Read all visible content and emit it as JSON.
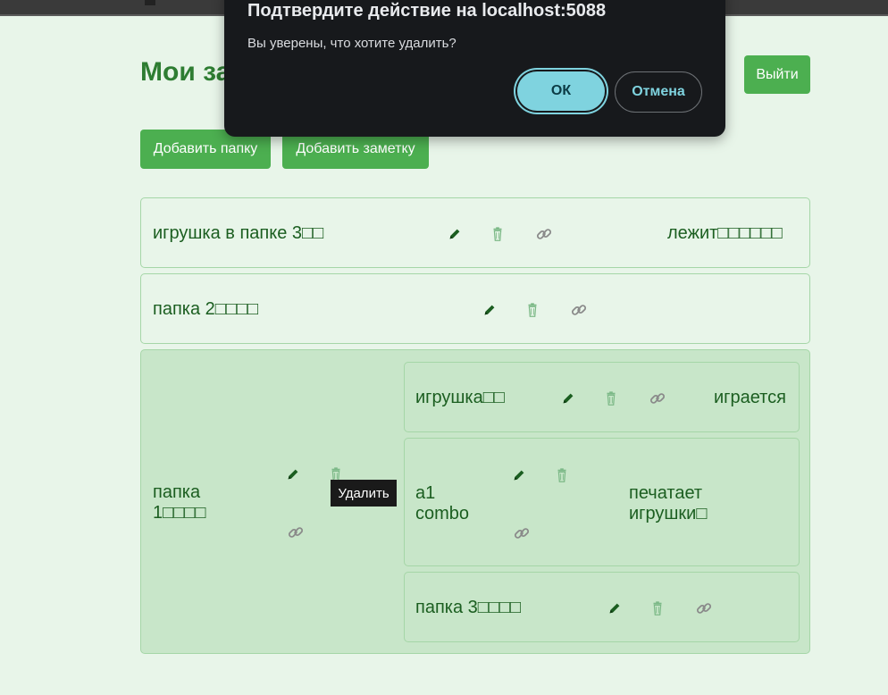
{
  "page": {
    "title": "Мои за"
  },
  "header": {
    "logout_label": "Выйти"
  },
  "toolbar": {
    "add_folder_label": "Добавить папку",
    "add_note_label": "Добавить заметку"
  },
  "items": [
    {
      "name": "игрушка в папке 3□□",
      "status": "лежит□□□□□□"
    },
    {
      "name": "папка 2□□□□"
    },
    {
      "name_line1": "папка",
      "name_line2": "1□□□□",
      "children": [
        {
          "name": "игрушка□□",
          "status": "играется"
        },
        {
          "name_line1": "a1",
          "name_line2": "combo",
          "status_line1": "печатает",
          "status_line2": "игрушки□"
        },
        {
          "name": "папка 3□□□□"
        }
      ]
    }
  ],
  "tooltip": {
    "text": "Удалить"
  },
  "dialog": {
    "title": "Подтвердите действие на localhost:5088",
    "message": "Вы уверены, что хотите удалить?",
    "ok_label": "ОК",
    "cancel_label": "Отмена"
  },
  "icons": {
    "edit": "pencil-icon",
    "delete": "trash-icon",
    "share": "link-icon"
  },
  "colors": {
    "accent": "#4caf50",
    "background": "#e8f5e9",
    "selected": "#c8e6c9",
    "dialog_bg": "#17191c",
    "dialog_accent": "#7fd3df"
  }
}
